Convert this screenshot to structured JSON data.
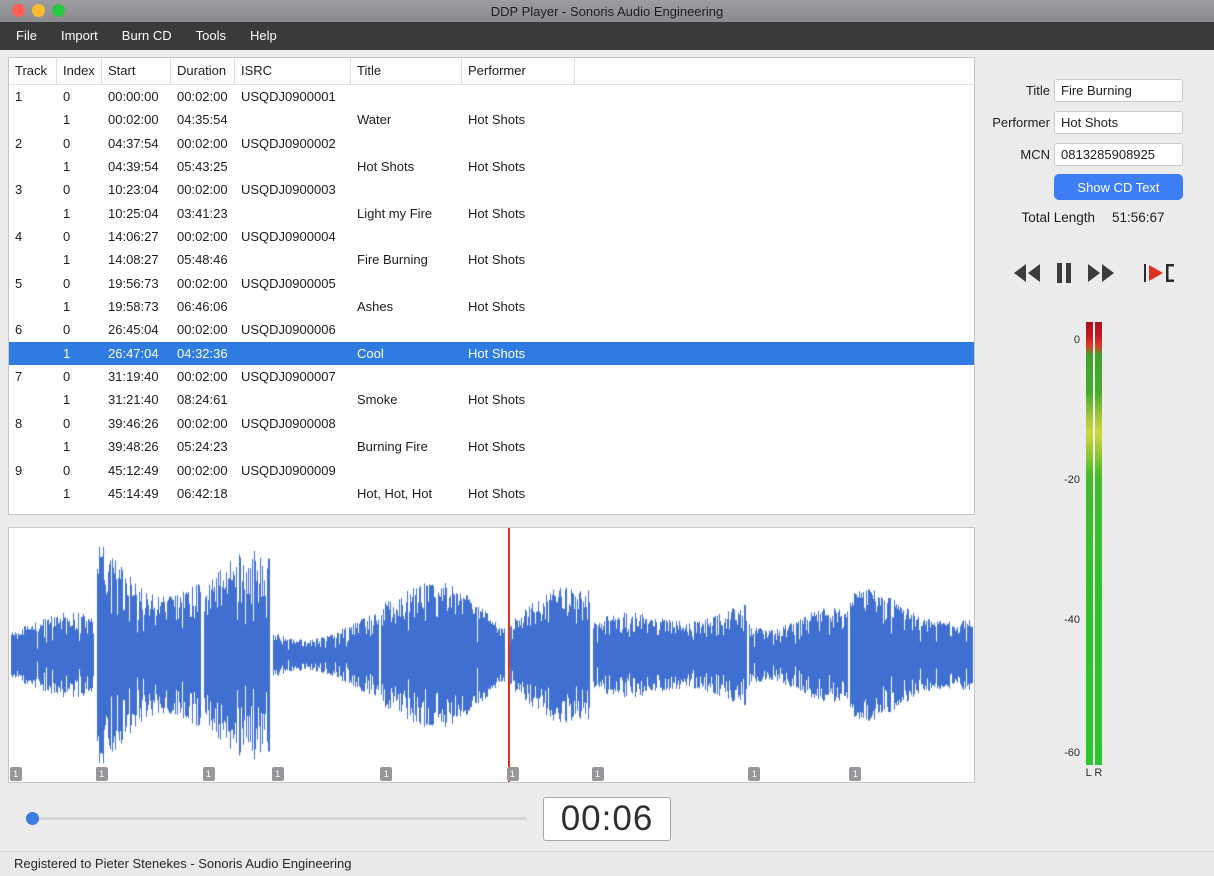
{
  "window": {
    "title": "DDP Player - Sonoris Audio Engineering"
  },
  "menu": {
    "items": [
      "File",
      "Import",
      "Burn CD",
      "Tools",
      "Help"
    ]
  },
  "track_table": {
    "columns": [
      "Track",
      "Index",
      "Start",
      "Duration",
      "ISRC",
      "Title",
      "Performer"
    ],
    "rows": [
      {
        "track": "1",
        "index": "0",
        "start": "00:00:00",
        "duration": "00:02:00",
        "isrc": "USQDJ0900001",
        "title": "",
        "performer": "",
        "selected": false
      },
      {
        "track": "",
        "index": "1",
        "start": "00:02:00",
        "duration": "04:35:54",
        "isrc": "",
        "title": "Water",
        "performer": "Hot Shots",
        "selected": false
      },
      {
        "track": "2",
        "index": "0",
        "start": "04:37:54",
        "duration": "00:02:00",
        "isrc": "USQDJ0900002",
        "title": "",
        "performer": "",
        "selected": false
      },
      {
        "track": "",
        "index": "1",
        "start": "04:39:54",
        "duration": "05:43:25",
        "isrc": "",
        "title": "Hot Shots",
        "performer": "Hot Shots",
        "selected": false
      },
      {
        "track": "3",
        "index": "0",
        "start": "10:23:04",
        "duration": "00:02:00",
        "isrc": "USQDJ0900003",
        "title": "",
        "performer": "",
        "selected": false
      },
      {
        "track": "",
        "index": "1",
        "start": "10:25:04",
        "duration": "03:41:23",
        "isrc": "",
        "title": "Light my Fire",
        "performer": "Hot Shots",
        "selected": false
      },
      {
        "track": "4",
        "index": "0",
        "start": "14:06:27",
        "duration": "00:02:00",
        "isrc": "USQDJ0900004",
        "title": "",
        "performer": "",
        "selected": false
      },
      {
        "track": "",
        "index": "1",
        "start": "14:08:27",
        "duration": "05:48:46",
        "isrc": "",
        "title": "Fire Burning",
        "performer": "Hot Shots",
        "selected": false
      },
      {
        "track": "5",
        "index": "0",
        "start": "19:56:73",
        "duration": "00:02:00",
        "isrc": "USQDJ0900005",
        "title": "",
        "performer": "",
        "selected": false
      },
      {
        "track": "",
        "index": "1",
        "start": "19:58:73",
        "duration": "06:46:06",
        "isrc": "",
        "title": "Ashes",
        "performer": "Hot Shots",
        "selected": false
      },
      {
        "track": "6",
        "index": "0",
        "start": "26:45:04",
        "duration": "00:02:00",
        "isrc": "USQDJ0900006",
        "title": "",
        "performer": "",
        "selected": false
      },
      {
        "track": "",
        "index": "1",
        "start": "26:47:04",
        "duration": "04:32:36",
        "isrc": "",
        "title": "Cool",
        "performer": "Hot Shots",
        "selected": true
      },
      {
        "track": "7",
        "index": "0",
        "start": "31:19:40",
        "duration": "00:02:00",
        "isrc": "USQDJ0900007",
        "title": "",
        "performer": "",
        "selected": false
      },
      {
        "track": "",
        "index": "1",
        "start": "31:21:40",
        "duration": "08:24:61",
        "isrc": "",
        "title": "Smoke",
        "performer": "Hot Shots",
        "selected": false
      },
      {
        "track": "8",
        "index": "0",
        "start": "39:46:26",
        "duration": "00:02:00",
        "isrc": "USQDJ0900008",
        "title": "",
        "performer": "",
        "selected": false
      },
      {
        "track": "",
        "index": "1",
        "start": "39:48:26",
        "duration": "05:24:23",
        "isrc": "",
        "title": "Burning Fire",
        "performer": "Hot Shots",
        "selected": false
      },
      {
        "track": "9",
        "index": "0",
        "start": "45:12:49",
        "duration": "00:02:00",
        "isrc": "USQDJ0900009",
        "title": "",
        "performer": "",
        "selected": false
      },
      {
        "track": "",
        "index": "1",
        "start": "45:14:49",
        "duration": "06:42:18",
        "isrc": "",
        "title": "Hot, Hot, Hot",
        "performer": "Hot Shots",
        "selected": false
      }
    ]
  },
  "details": {
    "title_label": "Title",
    "title_value": "Fire Burning",
    "performer_label": "Performer",
    "performer_value": "Hot Shots",
    "mcn_label": "MCN",
    "mcn_value": "0813285908925",
    "show_cd_text_label": "Show CD Text",
    "total_length_label": "Total Length",
    "total_length_value": "51:56:67"
  },
  "transport": {
    "buttons": [
      "rewind",
      "pause",
      "fast-forward",
      "play-marker"
    ]
  },
  "meter": {
    "scale": [
      "0",
      "-20",
      "-40",
      "-60"
    ],
    "channel_labels": "L R"
  },
  "waveform": {
    "total_length_seconds": 3116.893,
    "marker_label": "1",
    "playhead_seconds": 1613.053,
    "tracks": [
      {
        "start_seconds": 2.0,
        "duration_seconds": 275.72
      },
      {
        "start_seconds": 279.72,
        "duration_seconds": 343.333
      },
      {
        "start_seconds": 625.053,
        "duration_seconds": 221.307
      },
      {
        "start_seconds": 848.36,
        "duration_seconds": 348.613
      },
      {
        "start_seconds": 1198.973,
        "duration_seconds": 406.08
      },
      {
        "start_seconds": 1607.053,
        "duration_seconds": 272.48
      },
      {
        "start_seconds": 1881.533,
        "duration_seconds": 504.813
      },
      {
        "start_seconds": 2388.347,
        "duration_seconds": 324.307
      },
      {
        "start_seconds": 2714.653,
        "duration_seconds": 402.24
      }
    ]
  },
  "playbar": {
    "time_display": "00:06"
  },
  "statusbar": {
    "text": "Registered to Pieter Stenekes - Sonoris Audio Engineering"
  },
  "colors": {
    "selection": "#2e7ce1",
    "accent_button": "#3e7ef5",
    "waveform": "#3f6fd1",
    "playhead": "#e03022",
    "slider_knob": "#3b7de2"
  }
}
